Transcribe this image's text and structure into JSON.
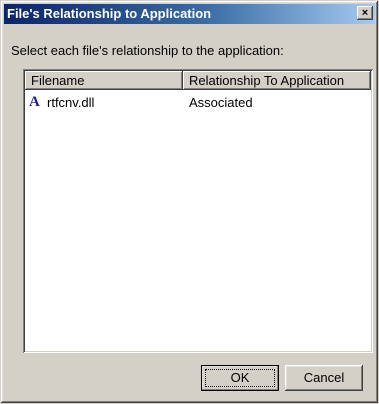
{
  "window": {
    "title": "File's Relationship to Application",
    "close_glyph": "×"
  },
  "instruction": "Select each file's relationship to the application:",
  "list": {
    "columns": [
      "Filename",
      "Relationship To Application"
    ],
    "rows": [
      {
        "icon": "font-file-icon",
        "icon_glyph": "A",
        "filename": "rtfcnv.dll",
        "relationship": "Associated"
      }
    ]
  },
  "buttons": {
    "ok": "OK",
    "cancel": "Cancel"
  },
  "colors": {
    "titlebar_start": "#0a246a",
    "titlebar_end": "#a6caf0",
    "face": "#d4d0c8"
  }
}
